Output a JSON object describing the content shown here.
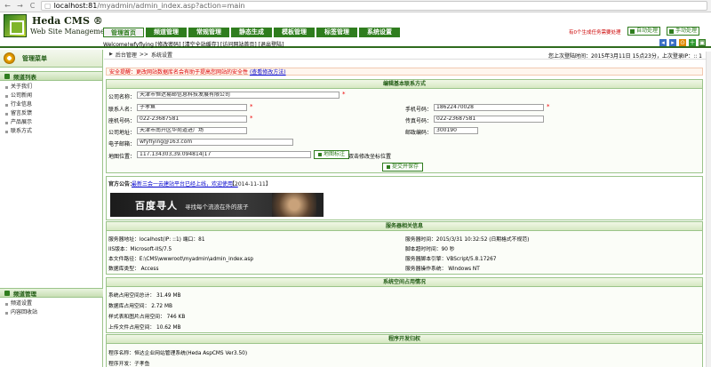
{
  "browser": {
    "back": "←",
    "forward": "→",
    "reload": "C",
    "page_icon": "▢",
    "url_host": "localhost:81",
    "url_path": "/myadmin/admin_index.asp?action=main"
  },
  "header": {
    "logo_title": "Heda CMS ®",
    "logo_subtitle": "Web Site Management",
    "nav": [
      {
        "label": "管理首页",
        "active": true
      },
      {
        "label": "频道管理",
        "active": false
      },
      {
        "label": "常规管理",
        "active": false
      },
      {
        "label": "静态生成",
        "active": false
      },
      {
        "label": "模板管理",
        "active": false
      },
      {
        "label": "标签管理",
        "active": false
      },
      {
        "label": "系统设置",
        "active": false
      }
    ],
    "alert": "有0个生成任务需要处理",
    "auto_btn": "自动处理",
    "manual_btn": "手动处理",
    "welcome": "Welcome!wfyflying [修改密码] [清空全站缓存] [访问网站首页] [退出登陆]",
    "tool_icons": [
      "◂",
      "▸",
      "⊙",
      "＋",
      "▣"
    ]
  },
  "sidebar": {
    "title": "管理菜单",
    "section1": "频道列表",
    "channels": [
      "关于我们",
      "公司新闻",
      "行业信息",
      "留言反馈",
      "产品展示",
      "联系方式"
    ],
    "section2": "频道管理",
    "manage": [
      "频道设置",
      "内容回收站"
    ]
  },
  "main": {
    "crumb_root": "后台管理",
    "crumb_sep": ">>",
    "crumb_current": "系统设置",
    "last_login": "您上次登陆时间：2015年3月11日 15点23分，上次登录IP：:: 1",
    "notice": "安全提醒：更改网站数据库名会有助于提高您网站的安全性",
    "notice_link": "(查看修改方法)",
    "basic_title": "编辑基本联系方式",
    "fields": {
      "company_label": "公司名称：",
      "company": "天津市恒达易邮信息科技发展有限公司",
      "contact_label": "联系人名：",
      "contact": "子孝鱼",
      "mobile_label": "手机号码：",
      "mobile": "18622470028",
      "fax_label": "座机号码：",
      "fax": "022-23687581",
      "fax2_label": "传真号码：",
      "fax2": "022-23687581",
      "address_label": "公司地址：",
      "address": "天津市南开区华苑道进广场",
      "zip_label": "邮政编码：",
      "zip": "300190",
      "email_label": "电子邮箱：",
      "email": "wfyflying@163.com",
      "map_label": "地图位置：",
      "map": "117.134303,39.094814|17",
      "map_btn": "地图标注",
      "map_hint": "双击修改坐标位置",
      "submit": "提交并保存"
    },
    "announce": {
      "label": "官方公告：",
      "link": "最新三会一云建站平台已经上线，欢迎使用...",
      "date": "【2014-11-11】"
    },
    "banner": {
      "brand": "百度寻人",
      "slogan": "寻找每个流浪在外的孩子"
    },
    "server_title": "服务器相关信息",
    "server": {
      "name": "服务器地址：localhost(IP: ::1) 端口：81",
      "time": "服务器时间：2015/3/31 10:32:52 (日期格式不规范)",
      "iis": "IIS版本：Microsoft-IIS/7.5",
      "timeout": "脚本超时时间：90 秒",
      "path": "本文件路径：E:\\CMS\\wwwroot\\myadmin\\admin_index.asp",
      "engine": "服务器脚本引擎：VBScript/5.8.17267",
      "db": "数据库类型： Access",
      "os": "服务器操作系统： Windows NT"
    },
    "space_title": "系统空间占用情况",
    "space": {
      "total": "系统占用空间总计：   31.49 MB",
      "db": "数据库占用空间：    2.72 MB",
      "style": "样式表和图片占用空间：   746 KB",
      "upload": "上传文件占用空间：   10.62 MB"
    },
    "dev_title": "程序开发归权",
    "dev": {
      "program": "程序名称：恒达企业网站管理系统(Heda AspCMS Ver3.50)",
      "author": "程序开发：子孝鱼"
    }
  },
  "colors": {
    "brand": "#2f7d1e",
    "notice": "#dd0000"
  }
}
